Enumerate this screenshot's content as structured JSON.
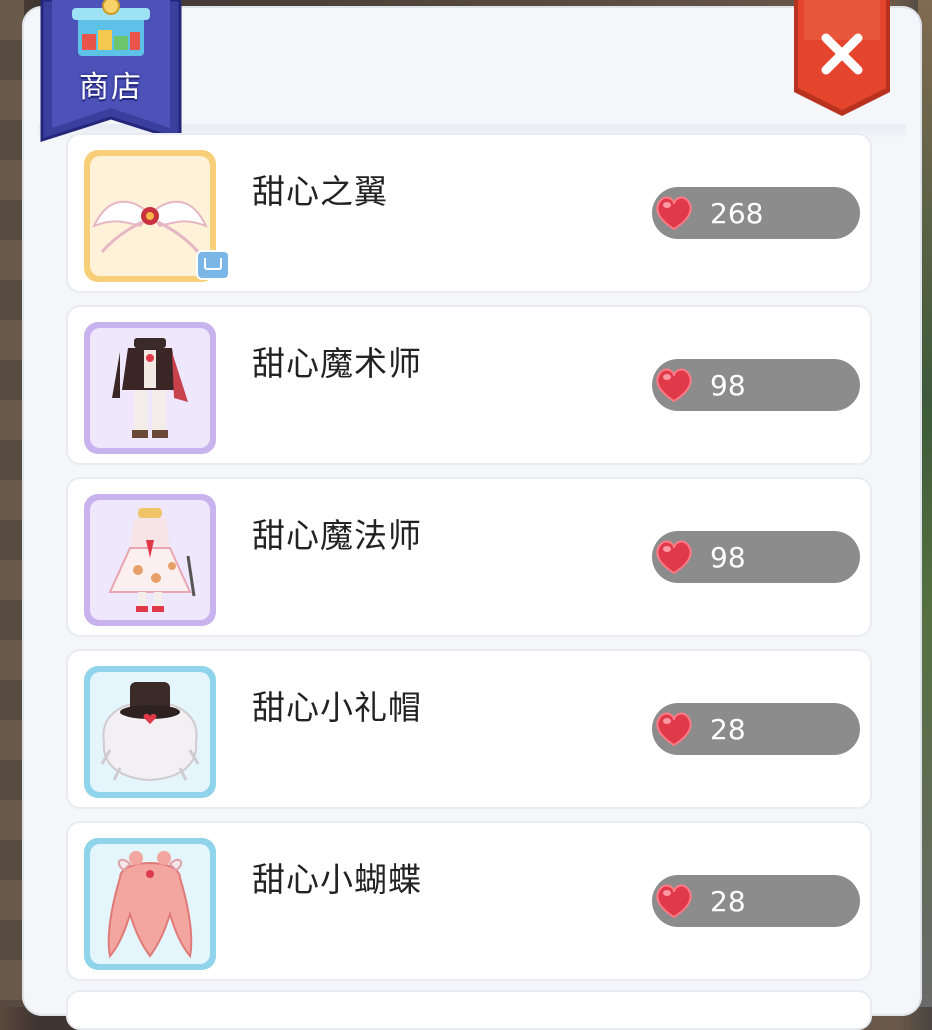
{
  "header": {
    "title": "商店",
    "close_icon": "close-icon"
  },
  "currency": {
    "icon": "heart-gem-icon",
    "color": "#e0394a"
  },
  "colors": {
    "rarity_gold": "#f7cf78",
    "rarity_purple": "#c9b3ee",
    "rarity_blue": "#8fd4ea",
    "close_red": "#e4452c",
    "tab_navy": "#3a3f9e"
  },
  "items": [
    {
      "name": "甜心之翼",
      "price": "268",
      "rarity": "gold",
      "icon": "angel-wings-icon"
    },
    {
      "name": "甜心魔术师",
      "price": "98",
      "rarity": "purple",
      "icon": "magician-outfit-icon"
    },
    {
      "name": "甜心魔法师",
      "price": "98",
      "rarity": "purple",
      "icon": "mage-dress-icon"
    },
    {
      "name": "甜心小礼帽",
      "price": "28",
      "rarity": "blue",
      "icon": "top-hat-icon"
    },
    {
      "name": "甜心小蝴蝶",
      "price": "28",
      "rarity": "blue",
      "icon": "bow-hairstyle-icon"
    }
  ]
}
